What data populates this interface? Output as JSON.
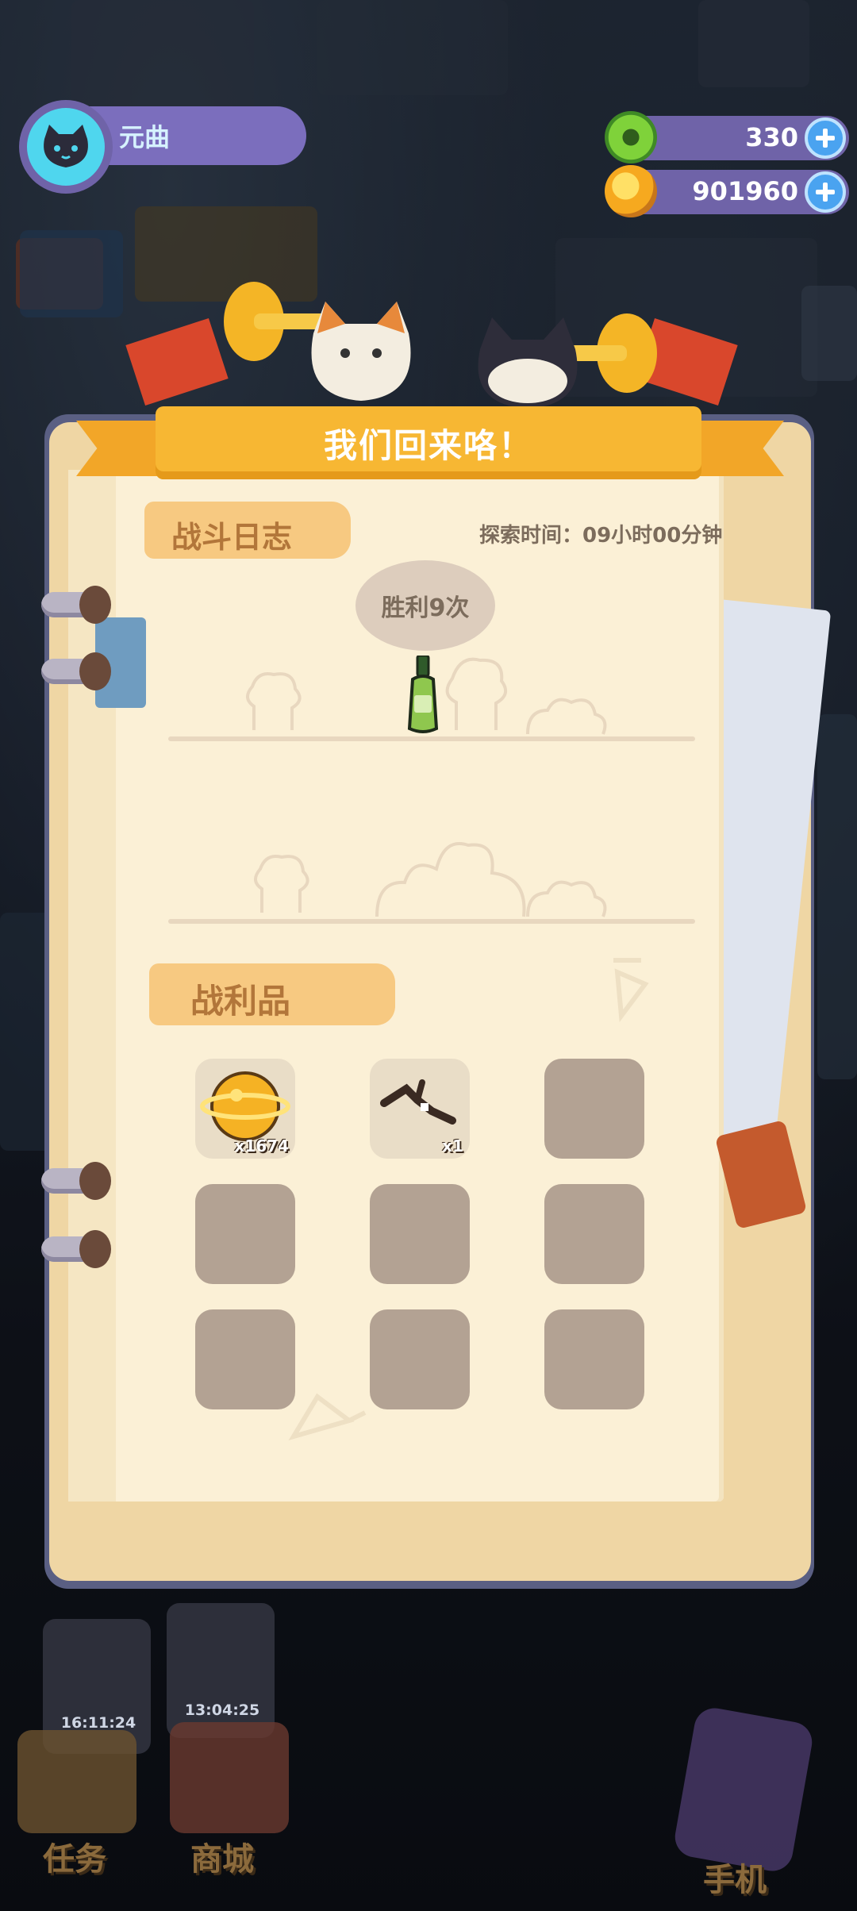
{
  "player": {
    "name": "元曲"
  },
  "resources": {
    "gems": "330",
    "coins": "901960"
  },
  "banner_title": "我们回来咯！",
  "battle_log": {
    "tab_label": "战斗日志",
    "explore_time": "探索时间：09小时00分钟",
    "result_bubble": "胜利9次"
  },
  "loot": {
    "tab_label": "战利品",
    "items": [
      {
        "icon": "gold-coin-icon",
        "count": "x1674"
      },
      {
        "icon": "branch-icon",
        "count": "x1"
      }
    ]
  },
  "bottom_nav": {
    "timers": [
      "16:11:24",
      "13:04:25"
    ],
    "labels": [
      "任务",
      "商城",
      "手机"
    ]
  },
  "colors": {
    "banner": "#f7b733",
    "tab": "#f7c981",
    "paper": "#fbf0d6",
    "empty_slot": "#b3a293",
    "plus_button": "#4aa3f0"
  }
}
